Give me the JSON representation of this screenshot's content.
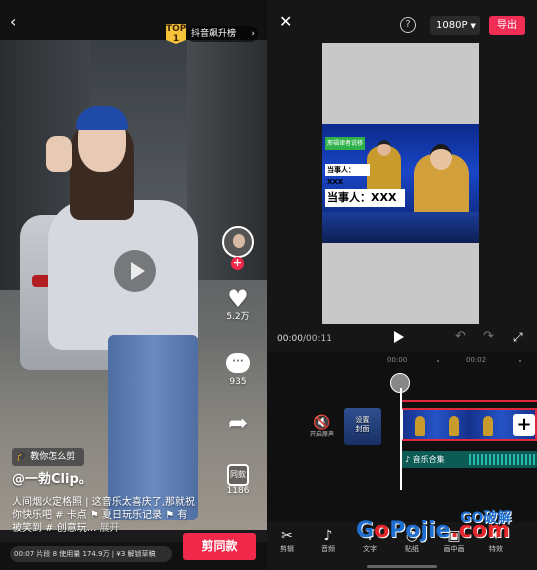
{
  "left_phone": {
    "top_badge": "TOP\n1",
    "rank_label": "抖音飙升榜",
    "likes": "5.2万",
    "comments": "935",
    "same_style_label": "同款",
    "same_style_count": "1186",
    "teach_label": "教你怎么剪",
    "author": "@一勃Clip。",
    "description": "人间烟火定格照 | 这音乐太喜庆了,那就祝你快乐吧 # 卡点 ⚑ 夏日玩乐记录 ⚑ 有被笑到 # 创意玩...",
    "expand_label": "展开",
    "template_info": "00:07 片段 8 使用量 174.9万 | ¥3 解锁草稿",
    "cut_same_button": "剪同款"
  },
  "right_phone": {
    "resolution": "1080P",
    "export_label": "导出",
    "preview": {
      "green_tag": "邢福律者说移",
      "lower_third_small": "当事人：XXX",
      "lower_third_big": "当事人：XXX"
    },
    "time_current": "00:00",
    "time_total": "00:11",
    "ruler": [
      "00:00",
      "00:02"
    ],
    "mute_label": "开启原声",
    "cover_label": "设置\n封面",
    "music_label": "♪ 音乐合集",
    "tools": [
      {
        "icon": "scissors-icon",
        "label": "剪辑"
      },
      {
        "icon": "music-note-icon",
        "label": "音频"
      },
      {
        "icon": "text-icon",
        "label": "文字"
      },
      {
        "icon": "sticker-icon",
        "label": "贴纸"
      },
      {
        "icon": "pip-icon",
        "label": "画中画"
      },
      {
        "icon": "effects-icon",
        "label": "特效"
      }
    ]
  },
  "watermark": {
    "main_a": "G",
    "main_o": "o",
    "main_rest": "Pojie",
    "suffix": ".com",
    "tag": "GO破解"
  },
  "colors": {
    "brand_red": "#f0284a",
    "export_red": "#f02e55",
    "timeline_red": "#e0283f",
    "music_teal": "#0d5b55"
  }
}
